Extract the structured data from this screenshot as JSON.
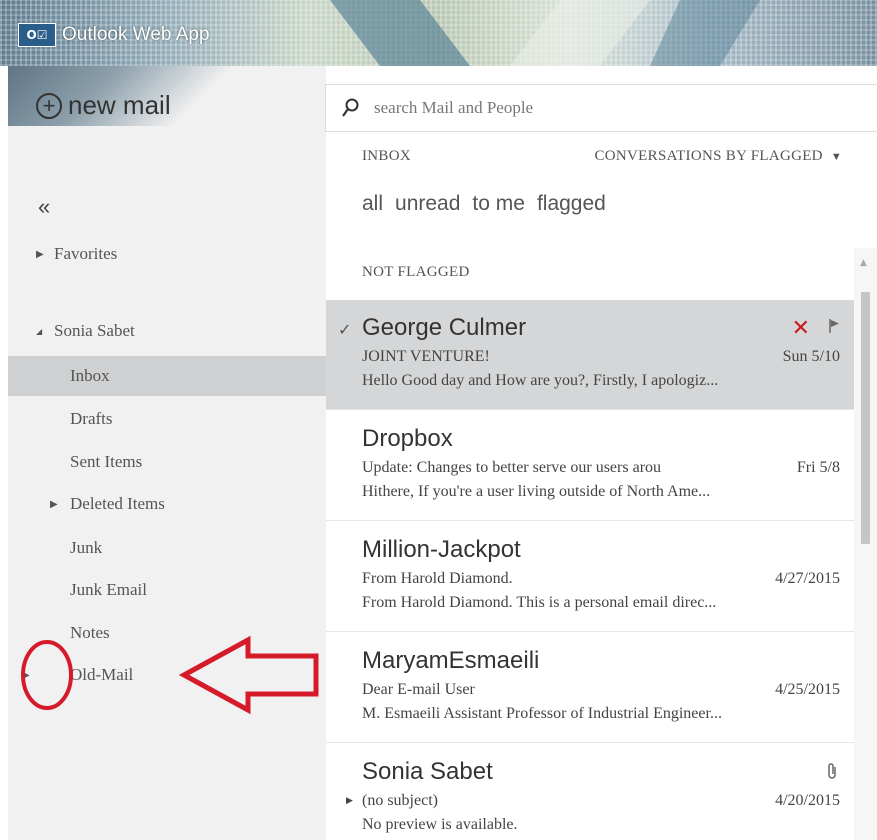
{
  "app": {
    "title": "Outlook Web App",
    "logo_text": "O☑"
  },
  "sidebar": {
    "new_mail_label": "new mail",
    "collapse_glyph": "«",
    "favorites_label": "Favorites",
    "account_label": "Sonia Sabet",
    "folders": [
      {
        "label": "Inbox",
        "selected": true
      },
      {
        "label": "Drafts"
      },
      {
        "label": "Sent Items"
      },
      {
        "label": "Deleted Items",
        "expandable": true
      },
      {
        "label": "Junk"
      },
      {
        "label": "Junk Email"
      },
      {
        "label": "Notes"
      },
      {
        "label": "Old-Mail",
        "expandable": true
      }
    ]
  },
  "search": {
    "placeholder": "search Mail and People"
  },
  "list": {
    "folder_label": "INBOX",
    "sort_label": "CONVERSATIONS BY FLAGGED",
    "filters": [
      "all",
      "unread",
      "to me",
      "flagged"
    ],
    "group_label": "NOT FLAGGED",
    "messages": [
      {
        "sender": "George Culmer",
        "subject": "JOINT VENTURE!",
        "date": "Sun 5/10",
        "preview": "Hello Good day and How are you?, Firstly, I apologiz...",
        "selected": true
      },
      {
        "sender": "Dropbox",
        "subject": "Update: Changes to better serve our users arou",
        "date": "Fri 5/8",
        "preview": "Hithere, If you're a user living outside of North Ame..."
      },
      {
        "sender": "Million-Jackpot",
        "subject": "From Harold Diamond.",
        "date": "4/27/2015",
        "preview": "From Harold Diamond. This is a personal email direc..."
      },
      {
        "sender": "MaryamEsmaeili",
        "subject": "Dear E-mail User",
        "date": "4/25/2015",
        "preview": "M. Esmaeili Assistant Professor of Industrial Engineer..."
      },
      {
        "sender": "Sonia Sabet",
        "subject": "(no subject)",
        "date": "4/20/2015",
        "preview": "No preview is available.",
        "has_attachment": true
      }
    ]
  },
  "icons": {
    "check": "✓",
    "delete": "✕",
    "attach": "⌀",
    "tri_right": "▶",
    "tri_down": "◢",
    "caret_down": "▼"
  },
  "colors": {
    "annotation": "#d51a2a",
    "delete": "#c81d1d",
    "selected_bg": "#d5d6d7"
  }
}
